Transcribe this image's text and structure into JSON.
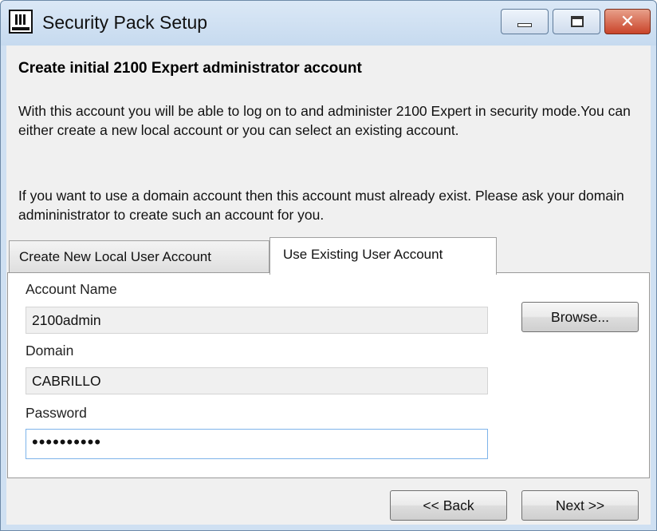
{
  "window": {
    "title": "Security Pack Setup",
    "close_label": "✕"
  },
  "page": {
    "heading": "Create initial 2100 Expert administrator account",
    "description_1": "With this account you will be able to log on to and administer 2100 Expert in security mode.You can either create a new local account or you can select an existing account.",
    "description_2": "If you want to use a domain account then this account must already exist. Please ask your domain admininistrator to create such an account for you."
  },
  "tabs": [
    {
      "label": "Create New Local User Account",
      "active": false
    },
    {
      "label": "Use Existing User Account",
      "active": true
    }
  ],
  "form": {
    "account_name_label": "Account Name",
    "account_name_value": "2100admin",
    "domain_label": "Domain",
    "domain_value": "CABRILLO",
    "password_label": "Password",
    "password_value": "••••••••••",
    "browse_label": "Browse..."
  },
  "footer": {
    "back_label": "<< Back",
    "next_label": "Next >>"
  },
  "colors": {
    "title_bar": "#c6daef",
    "dialog_bg": "#f0f0f0",
    "close_button": "#c9442a",
    "focus_border": "#7eb4ea"
  },
  "icons": [
    "app-icon",
    "minimize-icon",
    "maximize-icon",
    "close-icon"
  ]
}
